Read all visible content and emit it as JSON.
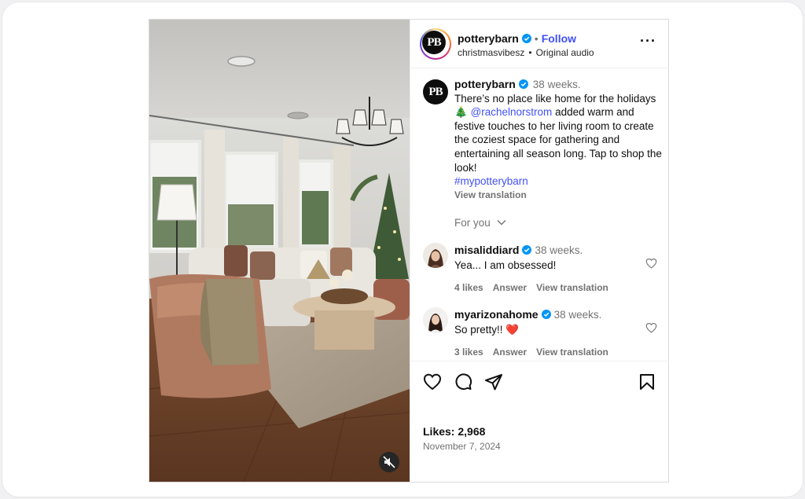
{
  "post": {
    "author": "potterybarn",
    "avatar_text": "PB",
    "follow_label": "Follow",
    "audio_user": "christmasvibesz",
    "audio_label": "Original audio",
    "more_icon": "more-horizontal-icon",
    "verified_color": "#0095f6",
    "accent_color": "#4150f7"
  },
  "caption": {
    "author": "potterybarn",
    "time": "38 weeks.",
    "text_before": "There’s no place like home for the holidays 🎄 ",
    "mention": "@rachelnorstrom",
    "text_after": " added warm and festive touches to her living room to create the coziest space for gathering and entertaining all season long. Tap to shop the look!",
    "hashtag": "#mypotterybarn",
    "view_translation": "View translation"
  },
  "for_you_label": "For you",
  "comments": [
    {
      "user": "misaliddiard",
      "time": "38 weeks.",
      "text": "Yea... I am obsessed!",
      "likes": "4 likes",
      "reply_label": "Answer",
      "translate_label": "View translation"
    },
    {
      "user": "myarizonahome",
      "time": "38 weeks.",
      "text": "So pretty!! ❤️",
      "likes": "3 likes",
      "reply_label": "Answer",
      "translate_label": "View translation"
    }
  ],
  "actions": {
    "icons": [
      "heart-icon",
      "comment-icon",
      "share-icon",
      "bookmark-icon"
    ],
    "likes_text": "Likes: 2,968",
    "date": "November 7, 2024"
  },
  "media": {
    "mute_icon": "speaker-muted-icon"
  }
}
